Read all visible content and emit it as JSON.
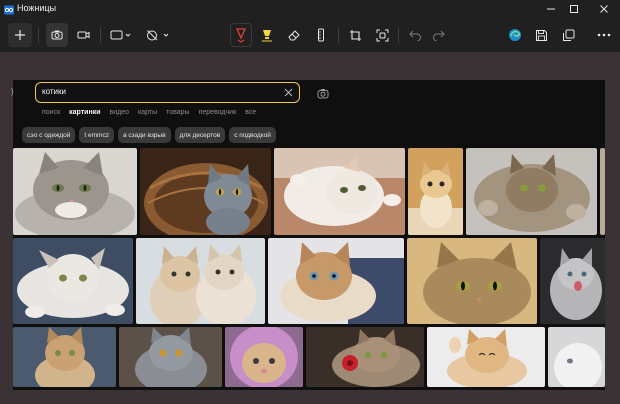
{
  "window": {
    "title": "Ножницы"
  },
  "search": {
    "query": "котики"
  },
  "tabs": [
    {
      "label": "поиск",
      "active": false
    },
    {
      "label": "картинки",
      "active": true
    },
    {
      "label": "видео",
      "active": false
    },
    {
      "label": "карты",
      "active": false
    },
    {
      "label": "товары",
      "active": false
    },
    {
      "label": "переводчик",
      "active": false
    },
    {
      "label": "все",
      "active": false
    }
  ],
  "chips": [
    "сэо с одеждой",
    "t emmcz",
    "а сзади взрыв",
    "для десертов",
    "с подводкой"
  ],
  "colors": {
    "accent": "#f2c94c",
    "pen_red": "#e0403a",
    "highlighter": "#f5d547",
    "canvas_background": "#3a3235"
  },
  "icons": {
    "new": "plus-icon",
    "screenshot_mode": "camera-icon",
    "video_mode": "video-icon",
    "shape": "rectangle-select-icon",
    "delay": "timer-off-icon",
    "pen": "pen-icon",
    "highlighter": "highlighter-icon",
    "eraser": "eraser-icon",
    "ruler": "ruler-icon",
    "crop": "crop-icon",
    "text_actions": "text-actions-icon",
    "undo": "undo-icon",
    "redo": "redo-icon",
    "edge": "edge-browser-icon",
    "save": "save-icon",
    "copy": "copy-icon",
    "more": "more-icon"
  },
  "images": [
    {
      "subject": "grey tabby kitten lying"
    },
    {
      "subject": "grey kitten in wicker basket"
    },
    {
      "subject": "white kitten lying on back"
    },
    {
      "subject": "small ginger kitten sitting"
    },
    {
      "subject": "tabby kitten lying on back"
    },
    {
      "subject": "white kitten lying on side"
    },
    {
      "subject": "two cream kittens"
    },
    {
      "subject": "fluffy ginger kitten"
    },
    {
      "subject": "tabby kitten face closeup"
    },
    {
      "subject": "grey kitten meowing"
    },
    {
      "subject": "ginger kitten sitting"
    },
    {
      "subject": "grey british kitten"
    },
    {
      "subject": "kitten in pink hood"
    },
    {
      "subject": "kitten with red flower"
    },
    {
      "subject": "ginger kitten stretching"
    },
    {
      "subject": "white kitten partial"
    }
  ]
}
